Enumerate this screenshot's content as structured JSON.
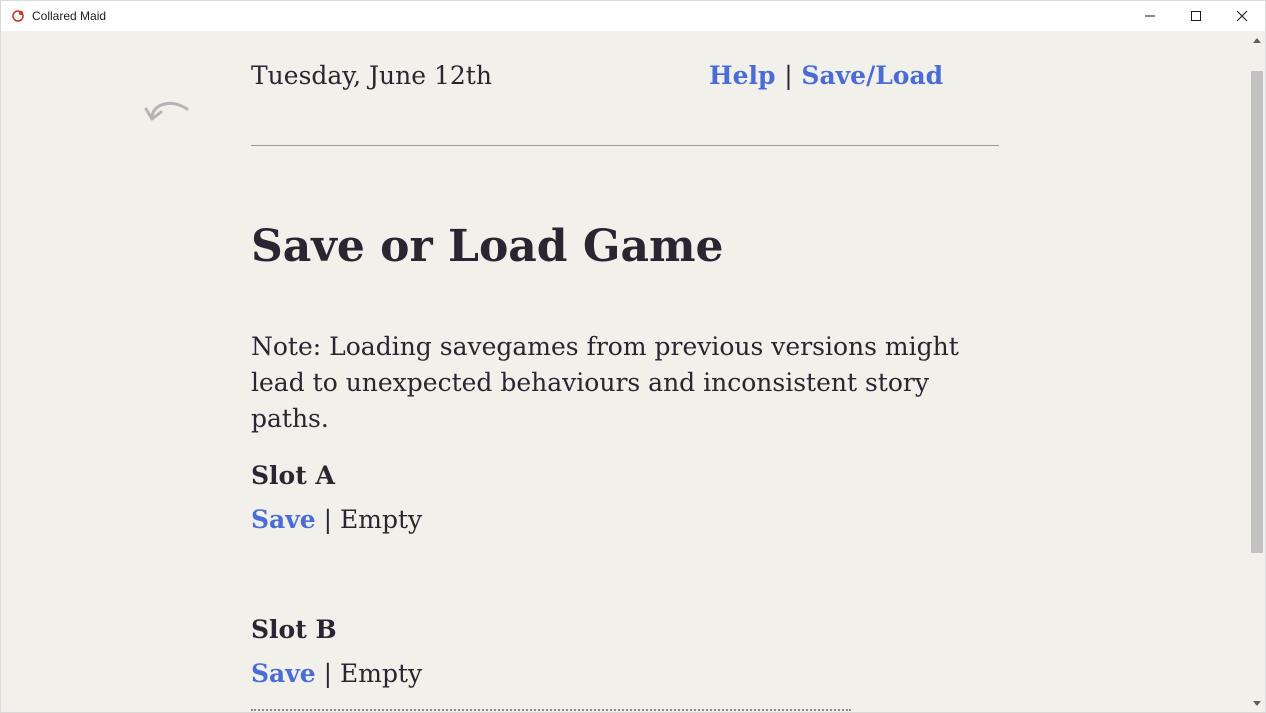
{
  "window": {
    "title": "Collared Maid"
  },
  "header": {
    "date": "Tuesday, June 12th",
    "help_label": "Help",
    "separator": "|",
    "saveload_label": "Save/Load"
  },
  "page": {
    "title": "Save or Load Game",
    "note": "Note: Loading savegames from previous versions might lead to unexpected behaviours and inconsistent story paths."
  },
  "slots": [
    {
      "title": "Slot A",
      "action_label": "Save",
      "separator": "|",
      "status": "Empty"
    },
    {
      "title": "Slot B",
      "action_label": "Save",
      "separator": "|",
      "status": "Empty"
    }
  ],
  "colors": {
    "background": "#f2f0eb",
    "text": "#2a2530",
    "link": "#4a6cd4",
    "divider": "#9a9a9a",
    "scroll_thumb": "#c2c2c2"
  },
  "icons": {
    "app": "collared-maid-app-icon",
    "back": "undo-arrow-icon",
    "minimize": "minimize-icon",
    "maximize": "maximize-icon",
    "close": "close-icon",
    "scroll_up": "scroll-up-arrow-icon",
    "scroll_down": "scroll-down-arrow-icon"
  }
}
